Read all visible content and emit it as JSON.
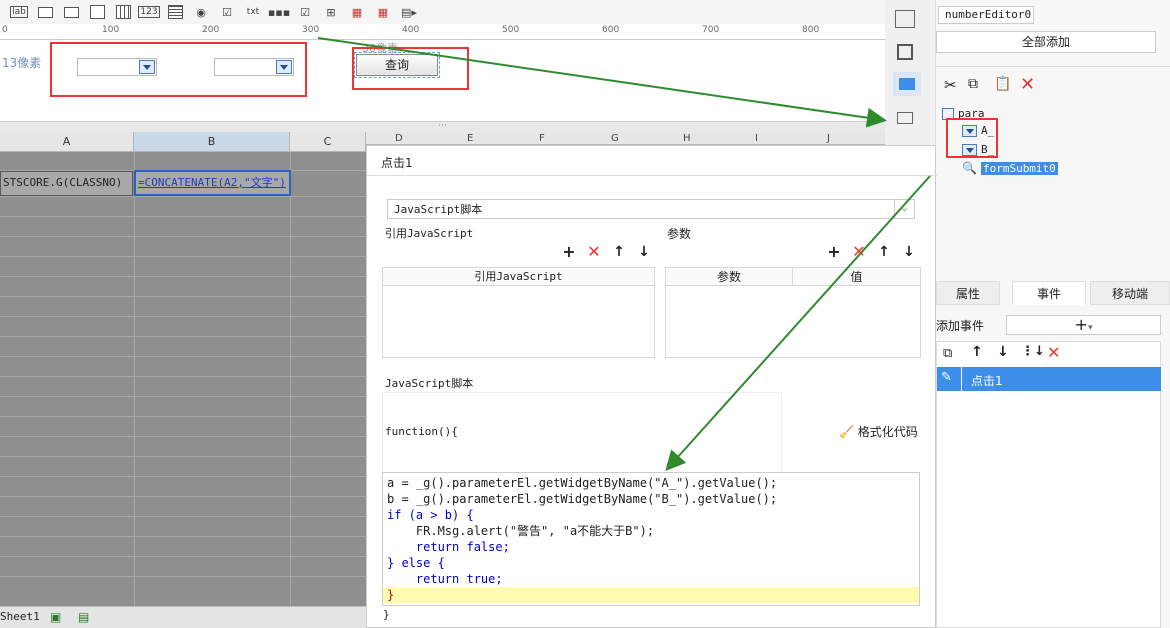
{
  "toolbar": {
    "items": [
      "lab-icon",
      "textbox-icon",
      "dropdown-icon",
      "form-icon",
      "calendar-icon",
      "number-icon",
      "textarea-icon",
      "radio-icon",
      "checkbox-icon",
      "txt-icon",
      "password-icon",
      "check-icon",
      "tree-icon",
      "date-icon",
      "datetime-icon",
      "more-icon"
    ],
    "lab_text": "lab",
    "number_text": "123",
    "txt_text": "txt"
  },
  "ruler": {
    "marks": [
      "0",
      "100",
      "200",
      "300",
      "400",
      "500",
      "600",
      "700",
      "800"
    ]
  },
  "canvas": {
    "left_label": "13像素",
    "query_label": "查询",
    "hidden_label": "30像素"
  },
  "grid": {
    "columns": [
      "A",
      "B",
      "C",
      "D",
      "E",
      "F",
      "G",
      "H",
      "I",
      "J"
    ],
    "cell_a2": "STSCORE.G(CLASSNO)",
    "cell_b2": "=CONCATENATE(A2,\"文字\")",
    "sheet_tab": "Sheet1"
  },
  "dialog": {
    "title": "点击1",
    "type_select": "JavaScript脚本",
    "ref_js_label": "引用JavaScript",
    "params_label": "参数",
    "ref_js_col": "引用JavaScript",
    "param_col": "参数",
    "value_col": "值",
    "script_label": "JavaScript脚本",
    "function_open": "function(){",
    "format_button": "格式化代码",
    "function_close": "}",
    "code_lines": [
      "a = _g().parameterEl.getWidgetByName(\"A_\").getValue();",
      "b = _g().parameterEl.getWidgetByName(\"B_\").getValue();",
      "if (a > b) {",
      "    FR.Msg.alert(\"警告\", \"a不能大于B\");",
      "    return false;",
      "} else {",
      "    return true;",
      "}"
    ]
  },
  "rpanel": {
    "widget_name": "numberEditor0",
    "add_all": "全部添加",
    "tree": {
      "root": "para",
      "a": "A_",
      "b": "B_",
      "submit": "formSubmit0"
    },
    "tabs": [
      "属性",
      "事件",
      "移动端"
    ],
    "add_event_label": "添加事件",
    "event_item": "点击1"
  },
  "colors": {
    "accent": "#3c8ee8",
    "red": "#e33333",
    "arrow": "#2e8b2e"
  }
}
